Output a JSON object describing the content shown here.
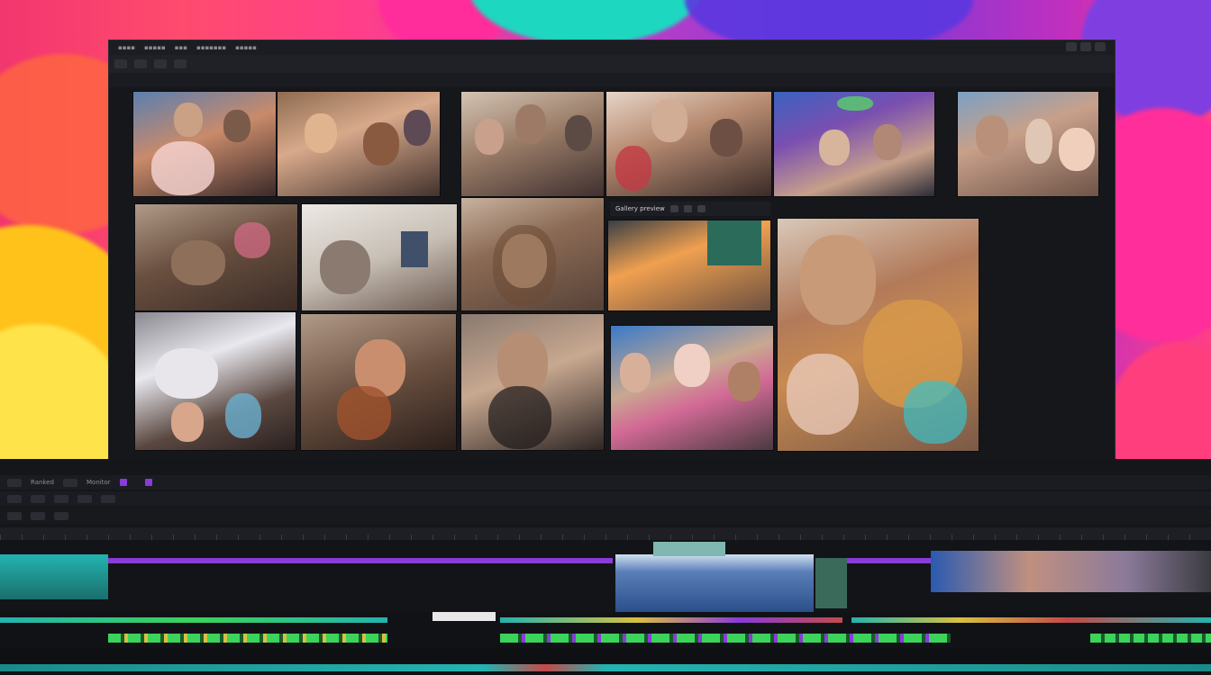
{
  "window": {
    "menu": [
      "▪▪▪▪",
      "▪▪▪▪▪",
      "▪▪▪",
      "▪▪▪▪▪▪▪",
      "▪▪▪▪▪"
    ],
    "toolbar_label": "",
    "tabs": [
      "",
      "",
      ""
    ]
  },
  "viewer": {
    "overlay_title": "Gallery preview",
    "clip_caption": "",
    "status": ""
  },
  "dock": {
    "tabs": [
      "",
      ""
    ],
    "row1_labels": [
      "Ranked",
      "Monitor",
      ""
    ],
    "row2_timecode": "",
    "ruler_label": "",
    "ruler_label_2": ""
  },
  "colors": {
    "accent_purple": "#7b3bd8",
    "clip_teal": "#23b3b0",
    "clip_green": "#3bd35a",
    "clip_purple": "#8a3bd8",
    "playhead_red": "#c34a4a"
  }
}
